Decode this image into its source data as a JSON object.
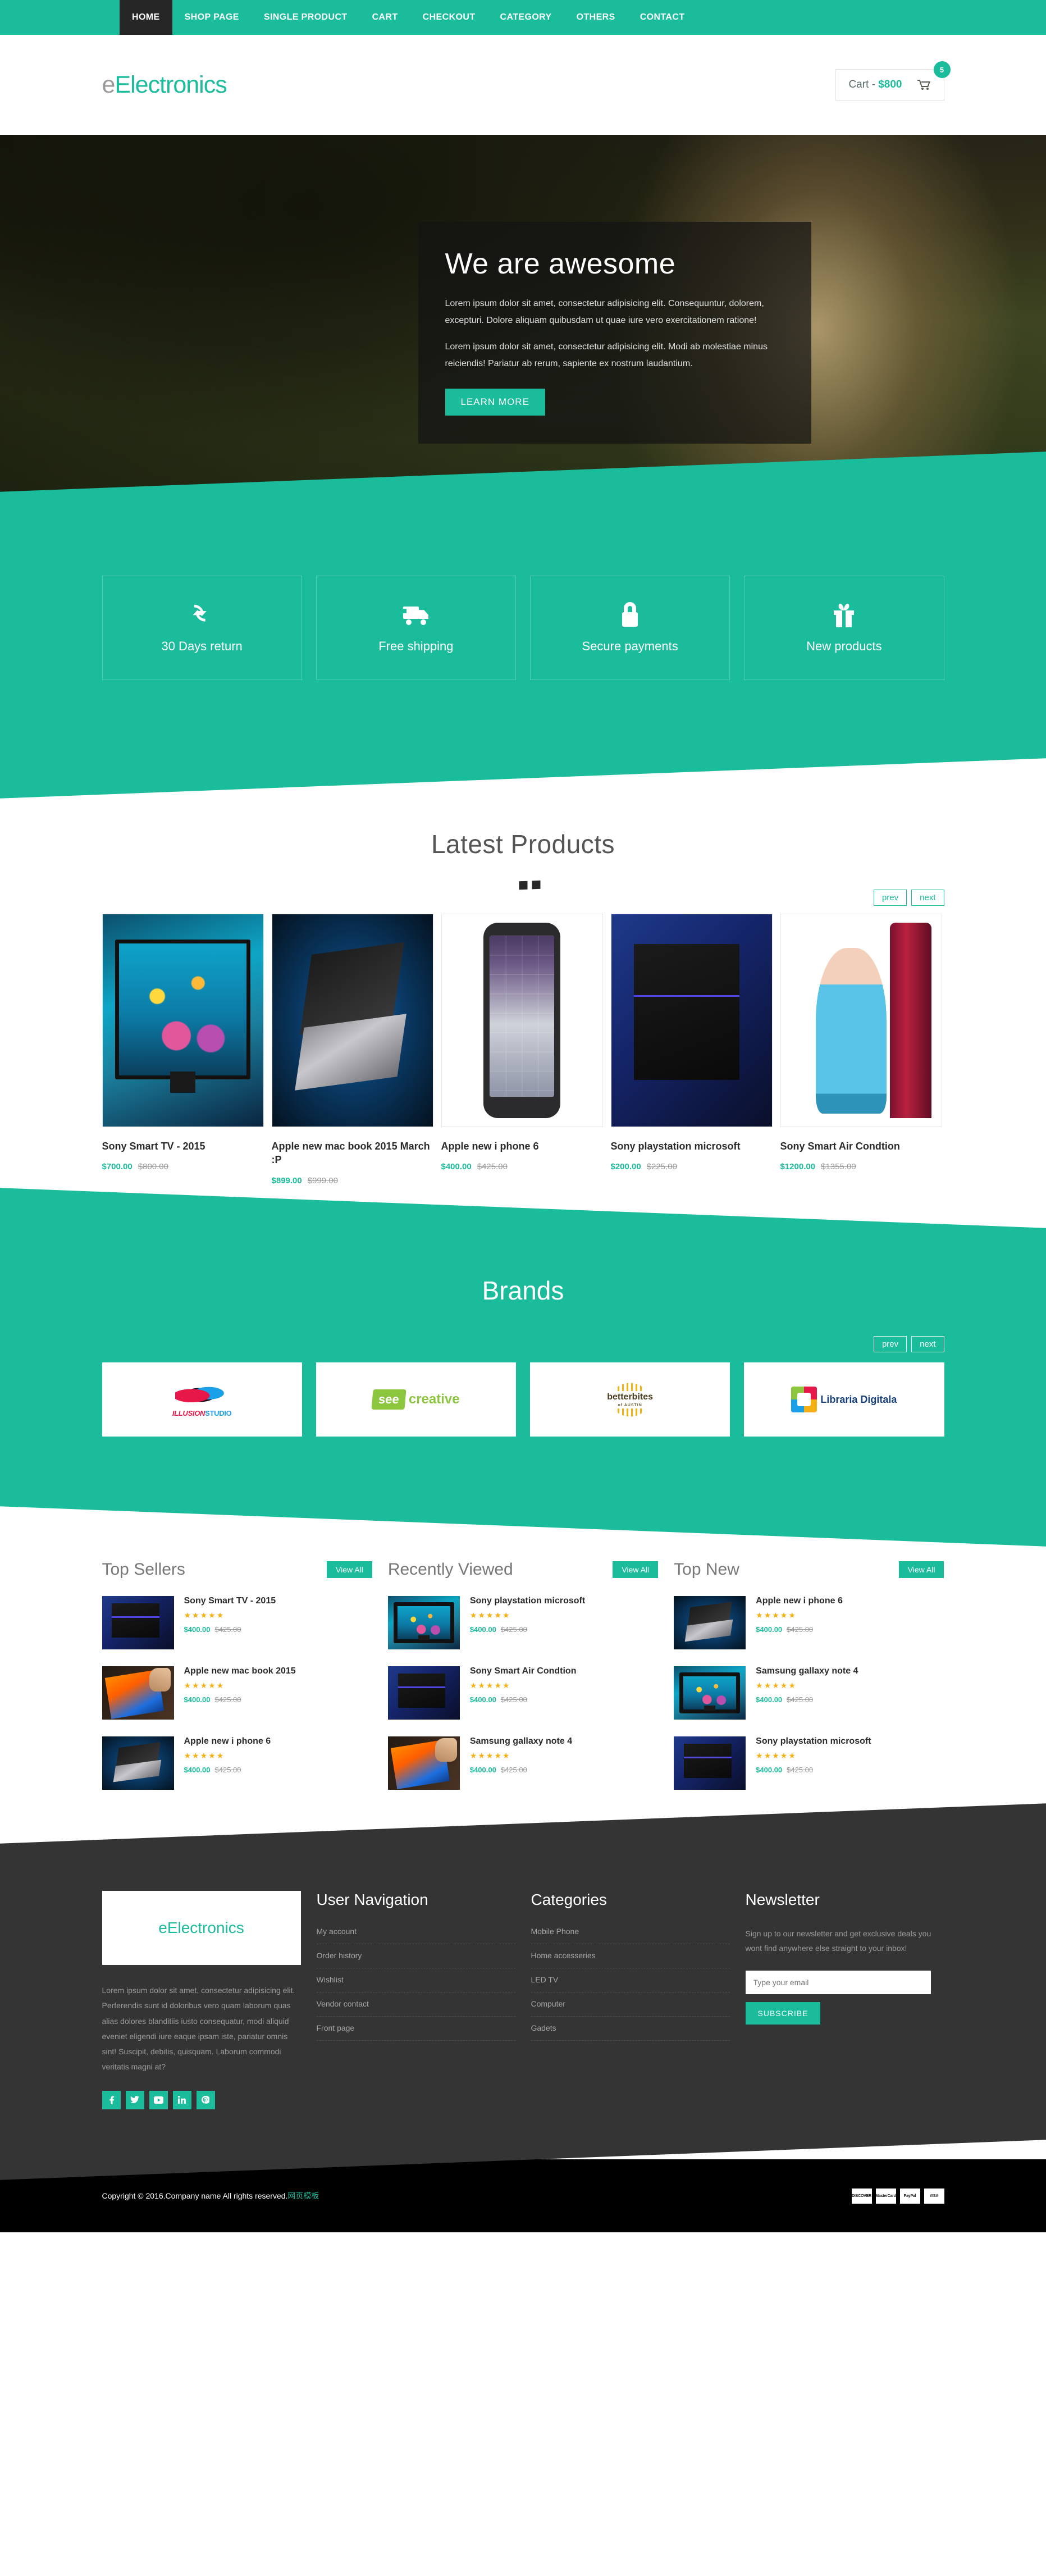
{
  "nav": {
    "items": [
      {
        "label": "HOME",
        "active": true
      },
      {
        "label": "SHOP PAGE",
        "active": false
      },
      {
        "label": "SINGLE PRODUCT",
        "active": false
      },
      {
        "label": "CART",
        "active": false
      },
      {
        "label": "CHECKOUT",
        "active": false
      },
      {
        "label": "CATEGORY",
        "active": false
      },
      {
        "label": "OTHERS",
        "active": false
      },
      {
        "label": "CONTACT",
        "active": false
      }
    ]
  },
  "brand": {
    "logo_first": "e",
    "logo_rest": "Electronics"
  },
  "cart": {
    "label": "Cart - ",
    "amount": "$800",
    "badge": "5",
    "icon": "shopping-cart-icon"
  },
  "hero": {
    "title": "We are awesome",
    "paragraph1": "Lorem ipsum dolor sit amet, consectetur adipisicing elit. Consequuntur, dolorem, excepturi. Dolore aliquam quibusdam ut quae iure vero exercitationem ratione!",
    "paragraph2": "Lorem ipsum dolor sit amet, consectetur adipisicing elit. Modi ab molestiae minus reiciendis! Pariatur ab rerum, sapiente ex nostrum laudantium.",
    "button": "LEARN MORE",
    "slides": 3,
    "active_slide": 1
  },
  "features": [
    {
      "label": "30 Days return",
      "icon": "refresh-cycle-icon"
    },
    {
      "label": "Free shipping",
      "icon": "truck-icon"
    },
    {
      "label": "Secure payments",
      "icon": "lock-icon"
    },
    {
      "label": "New products",
      "icon": "gift-icon"
    }
  ],
  "latest": {
    "title": "Latest Products",
    "prev": "prev",
    "next": "next",
    "products": [
      {
        "name": "Sony Smart TV - 2015",
        "new_price": "$700.00",
        "old_price": "$800.00",
        "art": "art-tv"
      },
      {
        "name": "Apple new mac book 2015 March :P",
        "new_price": "$899.00",
        "old_price": "$999.00",
        "art": "art-mac"
      },
      {
        "name": "Apple new i phone 6",
        "new_price": "$400.00",
        "old_price": "$425.00",
        "art": "art-iphone"
      },
      {
        "name": "Sony playstation microsoft",
        "new_price": "$200.00",
        "old_price": "$225.00",
        "art": "art-ps4"
      },
      {
        "name": "Sony Smart Air Condtion",
        "new_price": "$1200.00",
        "old_price": "$1355.00",
        "art": "art-ac"
      }
    ]
  },
  "brands": {
    "title": "Brands",
    "prev": "prev",
    "next": "next",
    "items": [
      {
        "name": "ILLUSION STUDIO",
        "logo": "illusion-studio-logo"
      },
      {
        "name": "see creative",
        "logo": "see-creative-logo"
      },
      {
        "name": "betterbites of AUSTIN",
        "logo": "betterbites-logo"
      },
      {
        "name": "Libraria Digitala",
        "logo": "libraria-digitala-logo"
      }
    ]
  },
  "lists": [
    {
      "title": "Top Sellers",
      "view_all": "View All",
      "items": [
        {
          "name": "Sony Smart TV - 2015",
          "rating": 5,
          "new_price": "$400.00",
          "old_price": "$425.00",
          "art": "art-ps4"
        },
        {
          "name": "Apple new mac book 2015",
          "rating": 5,
          "new_price": "$400.00",
          "old_price": "$425.00",
          "art": "art-note"
        },
        {
          "name": "Apple new i phone 6",
          "rating": 5,
          "new_price": "$400.00",
          "old_price": "$425.00",
          "art": "art-mac"
        }
      ]
    },
    {
      "title": "Recently Viewed",
      "view_all": "View All",
      "items": [
        {
          "name": "Sony playstation microsoft",
          "rating": 5,
          "new_price": "$400.00",
          "old_price": "$425.00",
          "art": "art-tv"
        },
        {
          "name": "Sony Smart Air Condtion",
          "rating": 5,
          "new_price": "$400.00",
          "old_price": "$425.00",
          "art": "art-ps4"
        },
        {
          "name": "Samsung gallaxy note 4",
          "rating": 5,
          "new_price": "$400.00",
          "old_price": "$425.00",
          "art": "art-note"
        }
      ]
    },
    {
      "title": "Top New",
      "view_all": "View All",
      "items": [
        {
          "name": "Apple new i phone 6",
          "rating": 5,
          "new_price": "$400.00",
          "old_price": "$425.00",
          "art": "art-mac"
        },
        {
          "name": "Samsung gallaxy note 4",
          "rating": 5,
          "new_price": "$400.00",
          "old_price": "$425.00",
          "art": "art-tv"
        },
        {
          "name": "Sony playstation microsoft",
          "rating": 5,
          "new_price": "$400.00",
          "old_price": "$425.00",
          "art": "art-ps4"
        }
      ]
    }
  ],
  "footer": {
    "about": {
      "logo_first": "e",
      "logo_rest": "Electronics",
      "text": "Lorem ipsum dolor sit amet, consectetur adipisicing elit. Perferendis sunt id doloribus vero quam laborum quas alias dolores blanditiis iusto consequatur, modi aliquid eveniet eligendi iure eaque ipsam iste, pariatur omnis sint! Suscipit, debitis, quisquam. Laborum commodi veritatis magni at?",
      "social": [
        {
          "name": "facebook-icon",
          "glyph": "f"
        },
        {
          "name": "twitter-icon",
          "glyph": "✉"
        },
        {
          "name": "youtube-icon",
          "glyph": "▶"
        },
        {
          "name": "linkedin-icon",
          "glyph": "in"
        },
        {
          "name": "pinterest-icon",
          "glyph": "P"
        }
      ]
    },
    "user_navigation": {
      "title": "User Navigation",
      "items": [
        "My account",
        "Order history",
        "Wishlist",
        "Vendor contact",
        "Front page"
      ]
    },
    "categories": {
      "title": "Categories",
      "items": [
        "Mobile Phone",
        "Home accesseries",
        "LED TV",
        "Computer",
        "Gadets"
      ]
    },
    "newsletter": {
      "title": "Newsletter",
      "text": "Sign up to our newsletter and get exclusive deals you wont find anywhere else straight to your inbox!",
      "placeholder": "Type your email",
      "value": "",
      "button": "SUBSCRIBE"
    }
  },
  "copyright": {
    "text": "Copyright © 2016.Company name All rights reserved.",
    "link": "网页模板",
    "payments": [
      "DISCOVER",
      "MasterCard",
      "PayPal",
      "VISA"
    ]
  },
  "colors": {
    "accent": "#1abc9c",
    "dark": "#262626",
    "footer": "#343434",
    "star": "#f5b014"
  }
}
